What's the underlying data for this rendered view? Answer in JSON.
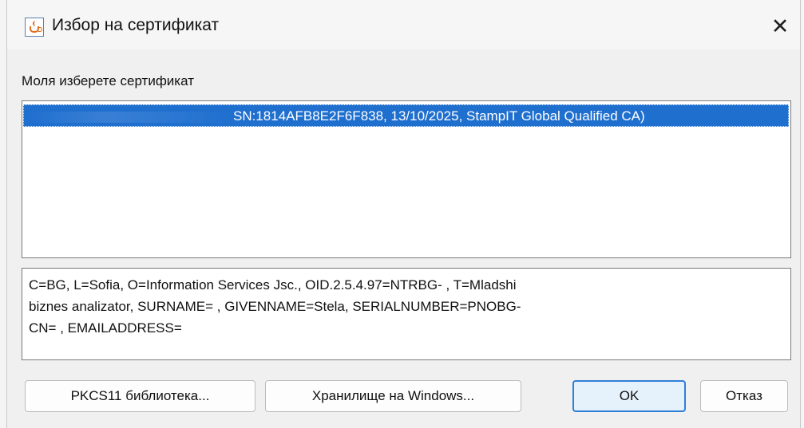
{
  "window": {
    "title": "Избор на сертификат",
    "close_label": "✕"
  },
  "prompt": "Моля изберете сертификат",
  "certificates": [
    {
      "label": "SN:1814AFB8E2F6F838, 13/10/2025, StampIT Global Qualified CA)",
      "selected": true
    }
  ],
  "details": {
    "lines": [
      "C=BG, L=Sofia, O=Information Services Jsc., OID.2.5.4.97=NTRBG-              , T=Mladshi",
      "biznes analizator, SURNAME=          , GIVENNAME=Stela, SERIALNUMBER=PNOBG-",
      "CN=                              , EMAILADDRESS="
    ]
  },
  "buttons": {
    "pkcs11": "PKCS11 библиотека...",
    "windows_store": "Хранилище на Windows...",
    "ok": "OK",
    "cancel": "Отказ"
  },
  "colors": {
    "selection": "#1f6fcf",
    "ok_border": "#2f7fd8"
  },
  "icons": {
    "app": "java-icon",
    "close": "close-icon"
  }
}
